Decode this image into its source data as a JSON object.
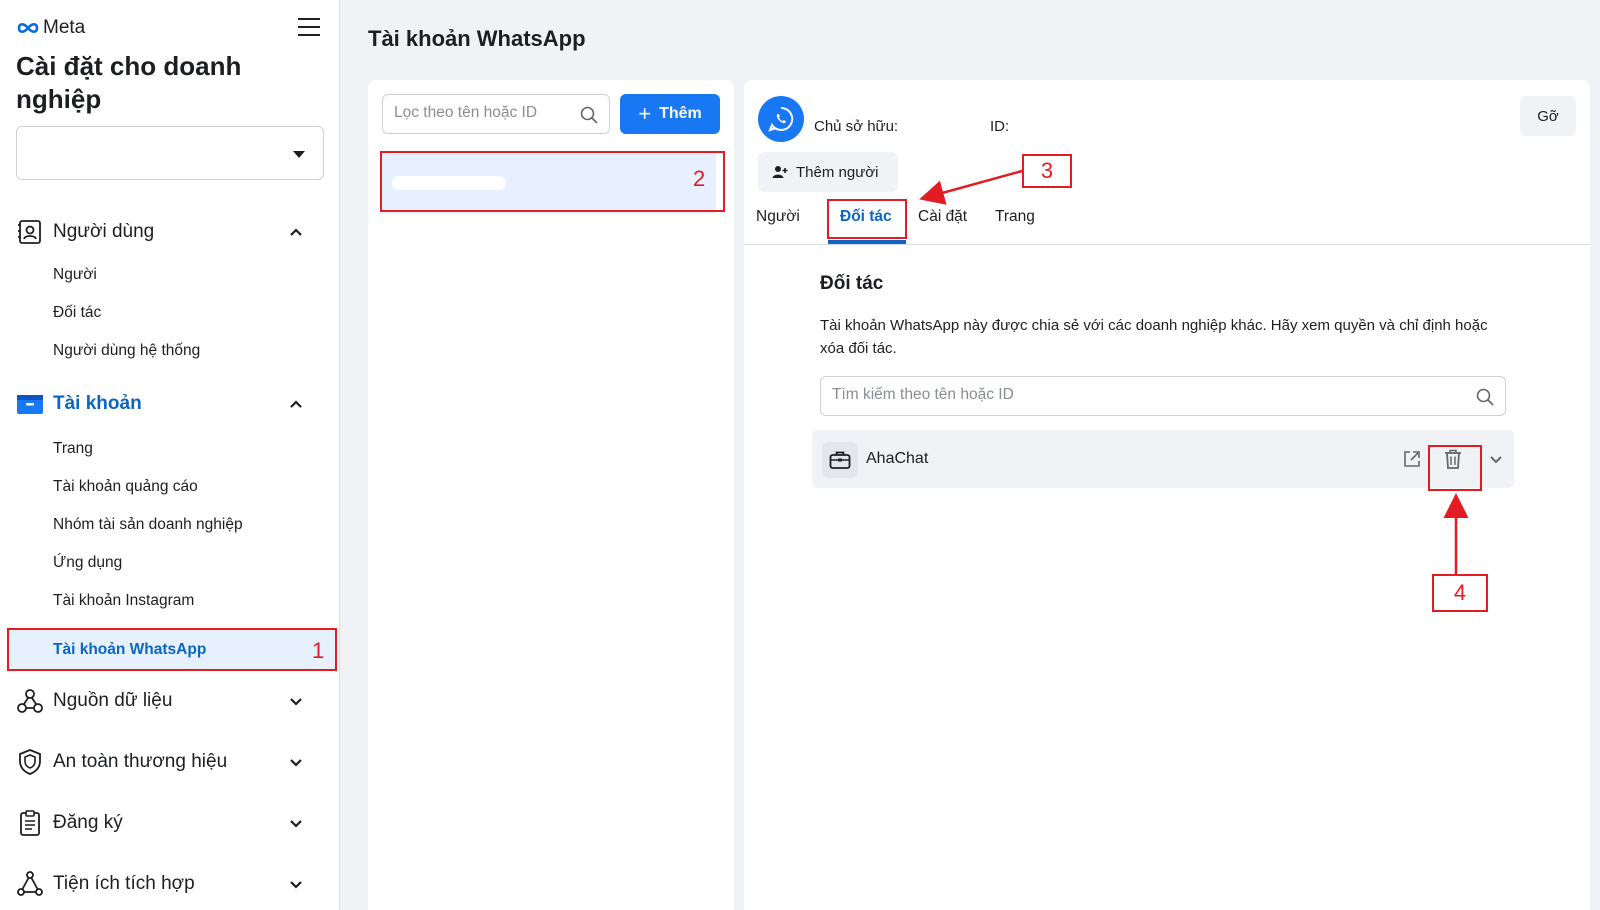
{
  "sidebar": {
    "brand": "Meta",
    "title": "Cài đặt cho doanh nghiệp",
    "business_select_value": "",
    "sections": [
      {
        "label": "Người dùng",
        "icon": "user-badge-icon",
        "expanded": true,
        "items": [
          "Người",
          "Đối tác",
          "Người dùng hệ thống"
        ]
      },
      {
        "label": "Tài khoản",
        "icon": "folder-icon",
        "expanded": true,
        "items": [
          "Trang",
          "Tài khoản quảng cáo",
          "Nhóm tài sản doanh nghiệp",
          "Ứng dụng",
          "Tài khoản Instagram",
          "Tài khoản WhatsApp"
        ]
      },
      {
        "label": "Nguồn dữ liệu",
        "icon": "data-sources-icon",
        "expanded": false
      },
      {
        "label": "An toàn thương hiệu",
        "icon": "shield-icon",
        "expanded": false
      },
      {
        "label": "Đăng ký",
        "icon": "clipboard-icon",
        "expanded": false
      },
      {
        "label": "Tiện ích tích hợp",
        "icon": "integrations-icon",
        "expanded": false
      }
    ],
    "active_item": "Tài khoản WhatsApp"
  },
  "page": {
    "title": "Tài khoản WhatsApp"
  },
  "list_panel": {
    "filter_placeholder": "Lọc theo tên hoặc ID",
    "add_label": "Thêm"
  },
  "detail": {
    "owner_label": "Chủ sở hữu:",
    "id_label": "ID:",
    "remove_label": "Gỡ",
    "add_people_label": "Thêm người",
    "tabs": [
      "Người",
      "Đối tác",
      "Cài đặt",
      "Trang"
    ],
    "active_tab": "Đối tác",
    "section_title": "Đối tác",
    "section_desc": "Tài khoản WhatsApp này được chia sẻ với các doanh nghiệp khác. Hãy xem quyền và chỉ định hoặc xóa đối tác.",
    "search_placeholder": "Tìm kiếm theo tên hoặc ID",
    "partners": [
      {
        "name": "AhaChat"
      }
    ]
  },
  "annotations": [
    "1",
    "2",
    "3",
    "4"
  ],
  "colors": {
    "accent": "#1877f2",
    "active_text": "#0a66c2",
    "annotation": "#e31c23",
    "background": "#f0f2f5"
  }
}
